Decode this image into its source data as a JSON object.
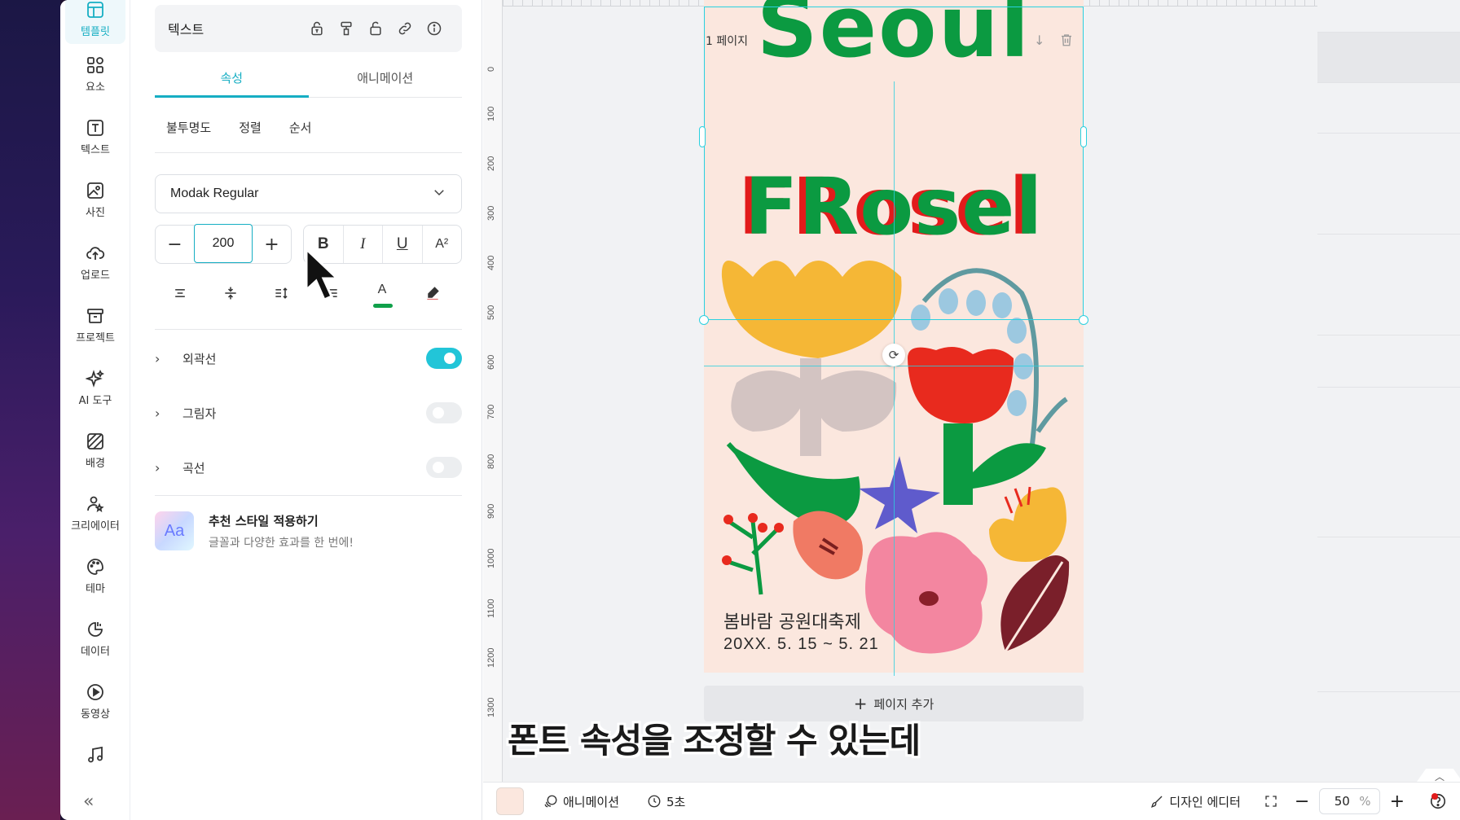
{
  "rail": [
    {
      "label": "템플릿",
      "icon": "template-icon",
      "active": true
    },
    {
      "label": "요소",
      "icon": "shapes-icon"
    },
    {
      "label": "텍스트",
      "icon": "text-icon"
    },
    {
      "label": "사진",
      "icon": "photo-icon"
    },
    {
      "label": "업로드",
      "icon": "upload-icon"
    },
    {
      "label": "프로젝트",
      "icon": "archive-icon"
    },
    {
      "label": "AI 도구",
      "icon": "sparkle-icon"
    },
    {
      "label": "배경",
      "icon": "background-icon"
    },
    {
      "label": "크리에이터",
      "icon": "creator-icon"
    },
    {
      "label": "테마",
      "icon": "palette-icon"
    },
    {
      "label": "데이터",
      "icon": "chart-icon"
    },
    {
      "label": "동영상",
      "icon": "play-icon"
    },
    {
      "label": "오디오",
      "icon": "music-icon"
    }
  ],
  "panel": {
    "toolbar_title": "텍스트",
    "tabs": [
      "속성",
      "애니메이션"
    ],
    "subtabs": [
      "불투명도",
      "정렬",
      "순서"
    ],
    "font": "Modak Regular",
    "font_size": "200",
    "style_buttons": {
      "bold": "B",
      "italic": "I",
      "underline": "U",
      "superscript": "A²"
    },
    "text_color": "#10a04a",
    "toggles": [
      {
        "label": "외곽선",
        "on": true
      },
      {
        "label": "그림자",
        "on": false
      },
      {
        "label": "곡선",
        "on": false
      }
    ],
    "suggest": {
      "thumb": "Aa",
      "title": "추천 스타일 적용하기",
      "desc": "글꼴과 다양한 효과를 한 번에!"
    }
  },
  "canvas": {
    "page_label": "1 페이지",
    "ruler_ticks": [
      "0",
      "100",
      "200",
      "300",
      "400",
      "500",
      "600",
      "700",
      "800",
      "900",
      "1000",
      "1100",
      "1200",
      "1300"
    ],
    "poster": {
      "title_line1": "Seoul",
      "title_line2": "FRosel",
      "subtitle": "봄바람 공원대축제",
      "dates": "20XX. 5. 15 ~ 5. 21",
      "bg": "#fbe7de"
    },
    "add_page": "페이지 추가",
    "caption": "폰트 속성을 조정할 수 있는데"
  },
  "bottombar": {
    "animation": "애니메이션",
    "duration": "5초",
    "design_editor": "디자인 에디터",
    "zoom": "50",
    "zoom_unit": "%"
  }
}
